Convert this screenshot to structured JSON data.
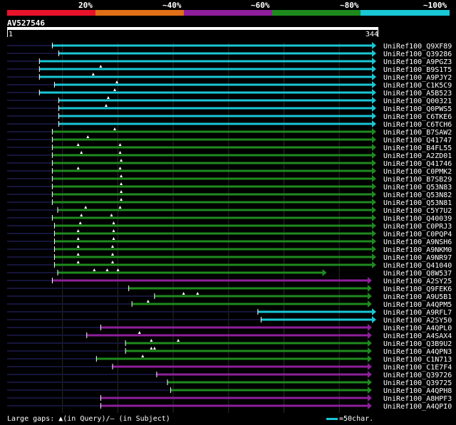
{
  "legend": {
    "segments": [
      {
        "label": "",
        "color": "#e8132a"
      },
      {
        "label": "20%",
        "color": "#e8132a"
      },
      {
        "label": "~40%",
        "color": "#e07018"
      },
      {
        "label": "~60%",
        "color": "#8e1f9b"
      },
      {
        "label": "~80%",
        "color": "#1e8a1e"
      },
      {
        "label": "~100%",
        "color": "#19c7d6"
      }
    ]
  },
  "query": {
    "name": "AV527546",
    "start": "1",
    "end": "344"
  },
  "footer": {
    "large_gaps": "Large gaps: ▲(in Query)/— (in Subject)",
    "scale": "=50char."
  },
  "chart_data": {
    "type": "alignment",
    "query_length": 344,
    "hits": [
      {
        "name": "UniRef100_Q9XF89",
        "start": 43,
        "end": 344,
        "identity": "~100%",
        "gaps": []
      },
      {
        "name": "UniRef100_Q39286",
        "start": 49,
        "end": 344,
        "identity": "~100%",
        "gaps": []
      },
      {
        "name": "UniRef100_A9PGZ3",
        "start": 31,
        "end": 344,
        "identity": "~100%",
        "gaps": []
      },
      {
        "name": "UniRef100_B9S1T5",
        "start": 31,
        "end": 344,
        "identity": "~100%",
        "gaps": [
          88
        ]
      },
      {
        "name": "UniRef100_A9PJY2",
        "start": 31,
        "end": 344,
        "identity": "~100%",
        "gaps": [
          81
        ]
      },
      {
        "name": "UniRef100_C1K5C9",
        "start": 45,
        "end": 344,
        "identity": "~100%",
        "gaps": [
          103
        ]
      },
      {
        "name": "UniRef100_A5B523",
        "start": 31,
        "end": 344,
        "identity": "~100%",
        "gaps": [
          101
        ]
      },
      {
        "name": "UniRef100_Q00321",
        "start": 49,
        "end": 344,
        "identity": "~100%",
        "gaps": [
          95
        ]
      },
      {
        "name": "UniRef100_Q0PWS5",
        "start": 49,
        "end": 344,
        "identity": "~100%",
        "gaps": [
          93
        ]
      },
      {
        "name": "UniRef100_C6TKE6",
        "start": 49,
        "end": 344,
        "identity": "~100%",
        "gaps": []
      },
      {
        "name": "UniRef100_C6TCH6",
        "start": 49,
        "end": 344,
        "identity": "~100%",
        "gaps": []
      },
      {
        "name": "UniRef100_B7SAW2",
        "start": 43,
        "end": 344,
        "identity": "~80%",
        "gaps": [
          101
        ]
      },
      {
        "name": "UniRef100_Q41747",
        "start": 43,
        "end": 344,
        "identity": "~80%",
        "gaps": [
          76
        ]
      },
      {
        "name": "UniRef100_B4FL55",
        "start": 43,
        "end": 344,
        "identity": "~80%",
        "gaps": [
          67,
          106
        ]
      },
      {
        "name": "UniRef100_A2ZD01",
        "start": 43,
        "end": 344,
        "identity": "~80%",
        "gaps": [
          70,
          106
        ]
      },
      {
        "name": "UniRef100_Q41746",
        "start": 43,
        "end": 344,
        "identity": "~80%",
        "gaps": [
          107
        ]
      },
      {
        "name": "UniRef100_C0PMK2",
        "start": 43,
        "end": 344,
        "identity": "~80%",
        "gaps": [
          67,
          106
        ]
      },
      {
        "name": "UniRef100_B7SB29",
        "start": 43,
        "end": 344,
        "identity": "~80%",
        "gaps": [
          107
        ]
      },
      {
        "name": "UniRef100_Q53N83",
        "start": 43,
        "end": 344,
        "identity": "~80%",
        "gaps": [
          107
        ]
      },
      {
        "name": "UniRef100_Q53N82",
        "start": 43,
        "end": 344,
        "identity": "~80%",
        "gaps": [
          107
        ]
      },
      {
        "name": "UniRef100_Q53N81",
        "start": 43,
        "end": 344,
        "identity": "~80%",
        "gaps": [
          107
        ]
      },
      {
        "name": "UniRef100_C5Y7U2",
        "start": 48,
        "end": 344,
        "identity": "~80%",
        "gaps": [
          74,
          106
        ]
      },
      {
        "name": "UniRef100_Q40039",
        "start": 43,
        "end": 344,
        "identity": "~80%",
        "gaps": [
          70,
          98
        ]
      },
      {
        "name": "UniRef100_C0PRJ3",
        "start": 45,
        "end": 344,
        "identity": "~80%",
        "gaps": [
          69,
          100
        ]
      },
      {
        "name": "UniRef100_C0PQP4",
        "start": 45,
        "end": 344,
        "identity": "~80%",
        "gaps": [
          67,
          100
        ]
      },
      {
        "name": "UniRef100_A9NSH6",
        "start": 45,
        "end": 344,
        "identity": "~80%",
        "gaps": [
          67,
          100
        ]
      },
      {
        "name": "UniRef100_A9NKM0",
        "start": 45,
        "end": 344,
        "identity": "~80%",
        "gaps": [
          67,
          99
        ]
      },
      {
        "name": "UniRef100_A9NR97",
        "start": 45,
        "end": 344,
        "identity": "~80%",
        "gaps": [
          67,
          99
        ]
      },
      {
        "name": "UniRef100_Q41040",
        "start": 45,
        "end": 344,
        "identity": "~80%",
        "gaps": [
          67,
          99
        ]
      },
      {
        "name": "UniRef100_Q8W537",
        "start": 48,
        "end": 298,
        "identity": "~80%",
        "gaps": [
          82,
          94,
          104
        ]
      },
      {
        "name": "UniRef100_A2SY25",
        "start": 43,
        "end": 340,
        "identity": "~60%",
        "gaps": []
      },
      {
        "name": "UniRef100_Q9FEK6",
        "start": 114,
        "end": 340,
        "identity": "~80%",
        "gaps": []
      },
      {
        "name": "UniRef100_A9U5B1",
        "start": 138,
        "end": 340,
        "identity": "~80%",
        "gaps": [
          165,
          178
        ]
      },
      {
        "name": "UniRef100_A4QPM5",
        "start": 117,
        "end": 340,
        "identity": "~80%",
        "gaps": [
          132
        ]
      },
      {
        "name": "UniRef100_A9RFL7",
        "start": 234,
        "end": 344,
        "identity": "~100%",
        "gaps": []
      },
      {
        "name": "UniRef100_A2SY50",
        "start": 237,
        "end": 344,
        "identity": "~100%",
        "gaps": []
      },
      {
        "name": "UniRef100_A4QPL0",
        "start": 88,
        "end": 340,
        "identity": "~60%",
        "gaps": []
      },
      {
        "name": "UniRef100_A4SAX4",
        "start": 75,
        "end": 340,
        "identity": "~60%",
        "gaps": [
          124
        ]
      },
      {
        "name": "UniRef100_Q3B9U2",
        "start": 111,
        "end": 340,
        "identity": "~80%",
        "gaps": [
          135,
          160
        ]
      },
      {
        "name": "UniRef100_A4QPN3",
        "start": 111,
        "end": 340,
        "identity": "~80%",
        "gaps": [
          135,
          138
        ]
      },
      {
        "name": "UniRef100_C1N713",
        "start": 84,
        "end": 340,
        "identity": "~80%",
        "gaps": [
          127
        ]
      },
      {
        "name": "UniRef100_C1E7F4",
        "start": 99,
        "end": 340,
        "identity": "~60%",
        "gaps": []
      },
      {
        "name": "UniRef100_Q39726",
        "start": 140,
        "end": 340,
        "identity": "~60%",
        "gaps": []
      },
      {
        "name": "UniRef100_Q39725",
        "start": 150,
        "end": 340,
        "identity": "~80%",
        "gaps": []
      },
      {
        "name": "UniRef100_A4QPH8",
        "start": 153,
        "end": 340,
        "identity": "~80%",
        "gaps": []
      },
      {
        "name": "UniRef100_A8HPF3",
        "start": 88,
        "end": 340,
        "identity": "~60%",
        "gaps": []
      },
      {
        "name": "UniRef100_A4QPI0",
        "start": 88,
        "end": 340,
        "identity": "~60%",
        "gaps": []
      }
    ]
  }
}
